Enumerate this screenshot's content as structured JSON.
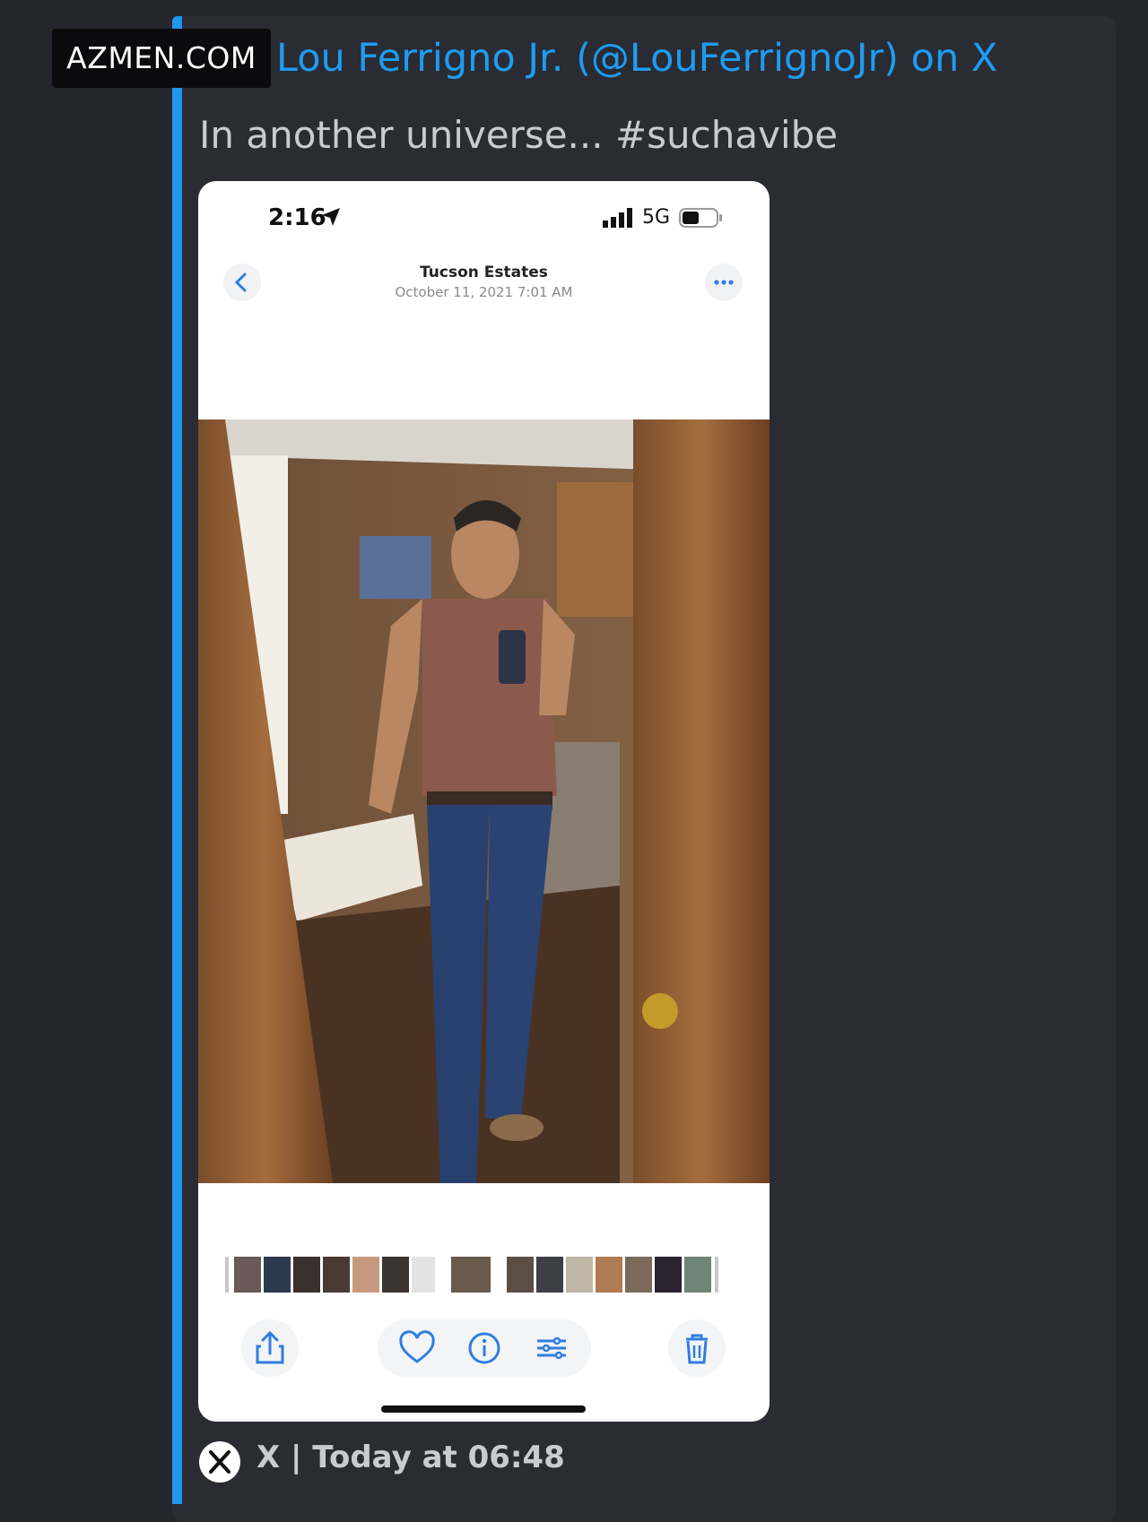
{
  "watermark": {
    "text": "AZMEN.COM"
  },
  "embed": {
    "title": "Lou Ferrigno Jr. (@LouFerrignoJr) on X",
    "description": "In another universe... #suchavibe",
    "footer": "X | Today at 06:48",
    "accent_color": "#1f97ec"
  },
  "phone": {
    "status": {
      "time": "2:16",
      "network": "5G"
    },
    "nav": {
      "title": "Tucson Estates",
      "subtitle": "October 11, 2021  7:01 AM",
      "back_icon": "chevron-left-icon",
      "more_icon": "ellipsis-icon"
    },
    "photo": {
      "description_icon": "photo"
    },
    "toolbar": {
      "icons": [
        "share-icon",
        "heart-icon",
        "info-icon",
        "adjust-icon",
        "trash-icon"
      ],
      "accent": "#2f7de1"
    }
  },
  "colors": {
    "background": "#25252d",
    "embed_bg": "#2a2b33",
    "link": "#1e9cf0",
    "text": "#c9cbd0"
  }
}
